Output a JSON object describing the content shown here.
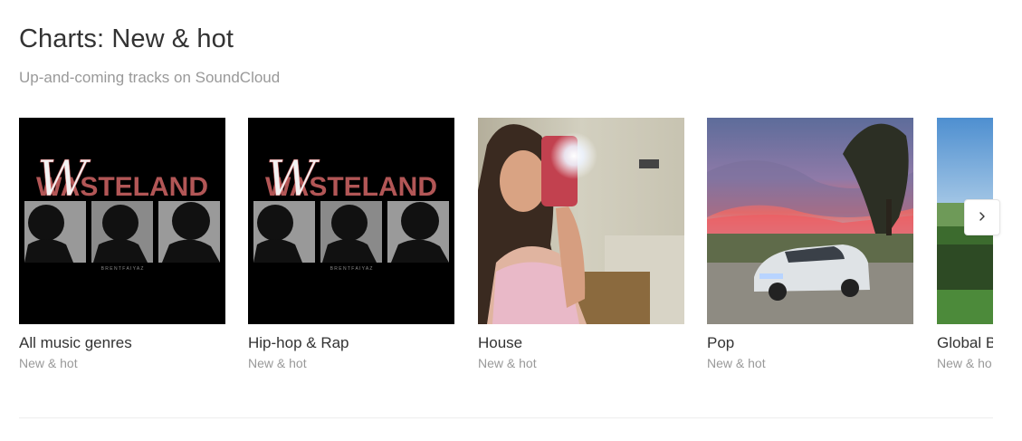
{
  "header": {
    "title": "Charts: New & hot",
    "subtitle": "Up-and-coming tracks on SoundCloud"
  },
  "cards": [
    {
      "title": "All music genres",
      "subtitle": "New & hot",
      "art_text": "WASTELAND",
      "art_script": "W",
      "art_footer": "B R E N T   F A I Y A Z"
    },
    {
      "title": "Hip-hop & Rap",
      "subtitle": "New & hot",
      "art_text": "WASTELAND",
      "art_script": "W",
      "art_footer": "B R E N T   F A I Y A Z"
    },
    {
      "title": "House",
      "subtitle": "New & hot"
    },
    {
      "title": "Pop",
      "subtitle": "New & hot"
    },
    {
      "title": "Global B",
      "subtitle": "New & ho"
    }
  ],
  "controls": {
    "next_icon": "chevron-right-icon"
  },
  "colors": {
    "title": "#333333",
    "muted": "#999999",
    "art_red": "#b25656"
  }
}
